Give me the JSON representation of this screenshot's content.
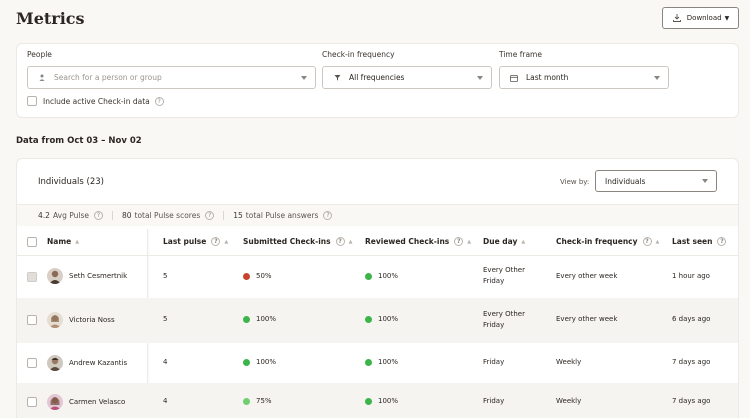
{
  "header": {
    "title": "Metrics",
    "download_label": "Download"
  },
  "filters": {
    "people": {
      "label": "People",
      "placeholder": "Search for a person or group"
    },
    "frequency": {
      "label": "Check-in frequency",
      "value": "All frequencies"
    },
    "timeframe": {
      "label": "Time frame",
      "value": "Last month"
    },
    "include_active_label": "Include active Check-in data"
  },
  "date_range": "Data from Oct 03 – Nov 02",
  "table": {
    "title": "Individuals (23)",
    "view_by_label": "View by:",
    "view_by_value": "Individuals",
    "stats": [
      {
        "value": "4.2",
        "label": "Avg Pulse"
      },
      {
        "value": "80",
        "label": "total Pulse scores"
      },
      {
        "value": "15",
        "label": "total Pulse answers"
      }
    ],
    "columns": {
      "name": "Name",
      "last_pulse": "Last pulse",
      "submitted": "Submitted Check-ins",
      "reviewed": "Reviewed Check-ins",
      "due_day": "Due day",
      "frequency": "Check-in frequency",
      "last_seen": "Last seen"
    },
    "rows": [
      {
        "name": "Seth Cesmertnik",
        "last_pulse": "5",
        "submitted": "50%",
        "submitted_color": "#c8452d",
        "reviewed": "100%",
        "reviewed_color": "#3bb54a",
        "due_day_1": "Every Other",
        "due_day_2": "Friday",
        "frequency": "Every other week",
        "last_seen": "1 hour ago",
        "avatar_color": "#8a6a55"
      },
      {
        "name": "Victoria Noss",
        "last_pulse": "5",
        "submitted": "100%",
        "submitted_color": "#3bb54a",
        "reviewed": "100%",
        "reviewed_color": "#3bb54a",
        "due_day_1": "Every Other",
        "due_day_2": "Friday",
        "frequency": "Every other week",
        "last_seen": "6 days ago",
        "avatar_color": "#b08f72"
      },
      {
        "name": "Andrew Kazantis",
        "last_pulse": "4",
        "submitted": "100%",
        "submitted_color": "#3bb54a",
        "reviewed": "100%",
        "reviewed_color": "#3bb54a",
        "due_day_1": "Friday",
        "due_day_2": "",
        "frequency": "Weekly",
        "last_seen": "7 days ago",
        "avatar_color": "#5c4a3e"
      },
      {
        "name": "Carmen Velasco",
        "last_pulse": "4",
        "submitted": "75%",
        "submitted_color": "#6fcf6f",
        "reviewed": "100%",
        "reviewed_color": "#3bb54a",
        "due_day_1": "Friday",
        "due_day_2": "",
        "frequency": "Weekly",
        "last_seen": "7 days ago",
        "avatar_color": "#b8527a"
      }
    ]
  },
  "colors": {
    "accent_red": "#c8452d",
    "accent_green": "#3bb54a",
    "accent_light_green": "#6fcf6f"
  }
}
